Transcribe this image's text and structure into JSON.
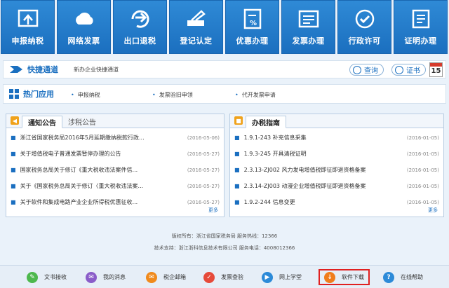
{
  "tiles": [
    {
      "label": "申报纳税",
      "icon": "declare-tax-icon"
    },
    {
      "label": "网络发票",
      "icon": "cloud-invoice-icon"
    },
    {
      "label": "出口退税",
      "icon": "export-refund-icon"
    },
    {
      "label": "登记认定",
      "icon": "register-icon"
    },
    {
      "label": "优惠办理",
      "icon": "discount-icon"
    },
    {
      "label": "发票办理",
      "icon": "invoice-icon"
    },
    {
      "label": "行政许可",
      "icon": "permit-icon"
    },
    {
      "label": "证明办理",
      "icon": "certificate-icon"
    }
  ],
  "quick": {
    "title": "快捷通道",
    "link": "新办企业快捷通道",
    "query_label": "查询",
    "cert_label": "证书",
    "calendar_day": "15"
  },
  "hot": {
    "title": "热门应用",
    "items": [
      "申报纳税",
      "发票验旧申领",
      "代开发票申请"
    ]
  },
  "notice": {
    "tab_active": "通知公告",
    "tab_inactive": "涉税公告",
    "more": "更多",
    "rows": [
      {
        "title": "浙江省国家税务局2016年5月延期缴纳税款行政...",
        "date": "(2016-05-06)"
      },
      {
        "title": "关于增值税电子普通发票暂停办理的公告",
        "date": "(2016-05-27)"
      },
      {
        "title": "国家税务总局关于修订《重大税收违法案件信...",
        "date": "(2016-05-27)"
      },
      {
        "title": "关于《国家税务总局关于修订〈重大税收违法案...",
        "date": "(2016-05-27)"
      },
      {
        "title": "关于软件和集成电路产业企业所得税优惠征收...",
        "date": "(2016-05-27)"
      }
    ]
  },
  "guide": {
    "tab_active": "办税指南",
    "more": "更多",
    "rows": [
      {
        "title": "1.9.1-243 补充信息采集",
        "date": "(2016-01-05)"
      },
      {
        "title": "1.9.3-245 开具清税证明",
        "date": "(2016-01-05)"
      },
      {
        "title": "2.3.13-ZJ002 风力发电增值税即征即退资格备案",
        "date": "(2016-01-05)"
      },
      {
        "title": "2.3.14-ZJ003 动漫企业增值税即征即退资格备案",
        "date": "(2016-01-05)"
      },
      {
        "title": "1.9.2-244 信息变更",
        "date": "(2016-01-05)"
      }
    ]
  },
  "footer": {
    "line1": "版权所有：浙江省国家税务局  服务热线：12366",
    "line2": "技术支持：浙江浙科信息技术有限公司  服务电话：4008012366"
  },
  "bottombar": [
    {
      "label": "文书接收",
      "icon": "document-receive-icon",
      "color": "#4db84d"
    },
    {
      "label": "我的消息",
      "icon": "message-icon",
      "color": "#8a5cc9"
    },
    {
      "label": "税企邮箱",
      "icon": "mail-icon",
      "color": "#f08a1c"
    },
    {
      "label": "发票查验",
      "icon": "invoice-check-icon",
      "color": "#e64a3a"
    },
    {
      "label": "网上学堂",
      "icon": "online-school-icon",
      "color": "#2c8ad8"
    },
    {
      "label": "软件下载",
      "icon": "download-icon",
      "color": "#f07d1c"
    },
    {
      "label": "在线帮助",
      "icon": "help-icon",
      "color": "#2c8ad8"
    }
  ]
}
